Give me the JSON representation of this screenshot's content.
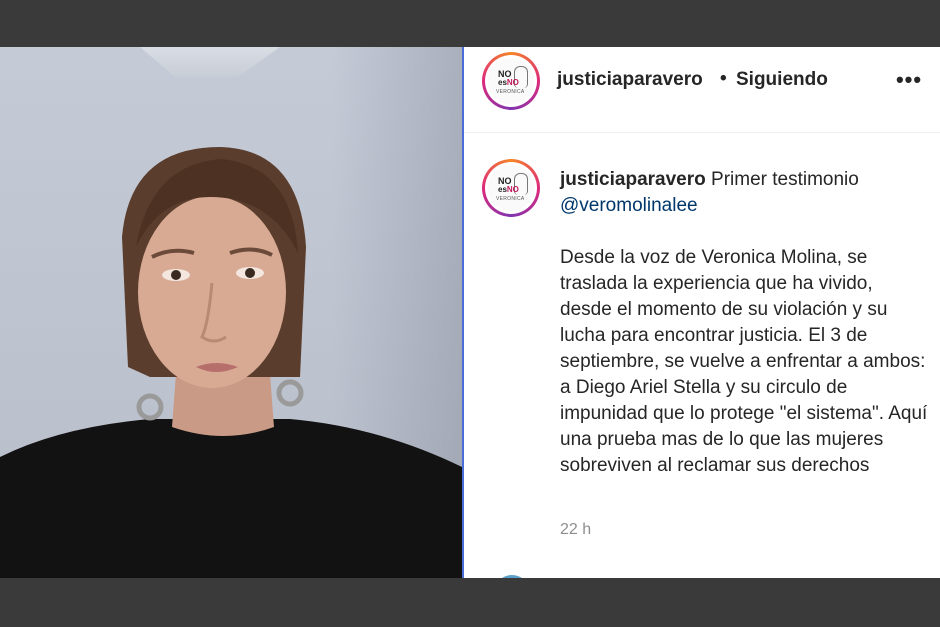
{
  "post_header": {
    "username": "justiciaparavero",
    "separator": "•",
    "follow_status": "Siguiendo",
    "more_icon": "more-horizontal-icon"
  },
  "avatar_logo": {
    "line1": "NO",
    "line2_a": "es",
    "line2_b": "NO",
    "line3": "VERONICA"
  },
  "caption": {
    "username": "justiciaparavero",
    "intro": "Primer testimonio",
    "mention": "@veromolinalee",
    "body": "Desde la voz de Veronica Molina, se traslada la experiencia que ha vivido, desde el momento de su violación y su lucha para encontrar justicia. El 3 de septiembre, se vuelve a enfrentar a ambos: a Diego Ariel Stella y su circulo de impunidad que lo protege \"el sistema\". Aquí una prueba mas de lo que las mujeres sobreviven al reclamar sus derechos",
    "timestamp": "22 h"
  },
  "colors": {
    "link": "#00376b",
    "text": "#262626",
    "muted": "#8e8e8e",
    "divider": "#4a6ed8"
  }
}
